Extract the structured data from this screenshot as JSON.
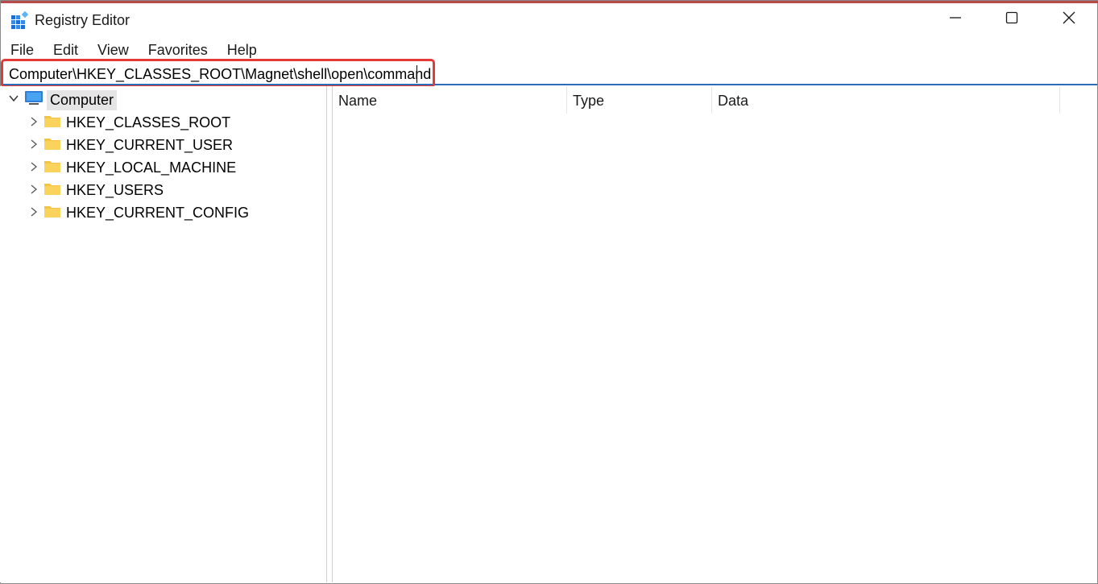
{
  "window": {
    "title": "Registry Editor",
    "icon": "registry-editor-icon",
    "controls": {
      "minimize": "minimize-icon",
      "maximize": "maximize-icon",
      "close": "close-icon"
    }
  },
  "menu": {
    "items": [
      "File",
      "Edit",
      "View",
      "Favorites",
      "Help"
    ]
  },
  "address": {
    "value": "Computer\\HKEY_CLASSES_ROOT\\Magnet\\shell\\open\\command",
    "highlight_color": "#e53935"
  },
  "tree": {
    "root": {
      "label": "Computer",
      "icon": "computer-icon",
      "expanded": true
    },
    "items": [
      {
        "label": "HKEY_CLASSES_ROOT"
      },
      {
        "label": "HKEY_CURRENT_USER"
      },
      {
        "label": "HKEY_LOCAL_MACHINE"
      },
      {
        "label": "HKEY_USERS"
      },
      {
        "label": "HKEY_CURRENT_CONFIG"
      }
    ]
  },
  "list": {
    "columns": [
      "Name",
      "Type",
      "Data"
    ]
  },
  "colors": {
    "accent": "#2b6cb8",
    "folder": "#f5c342",
    "selection": "#e5e5e5"
  }
}
